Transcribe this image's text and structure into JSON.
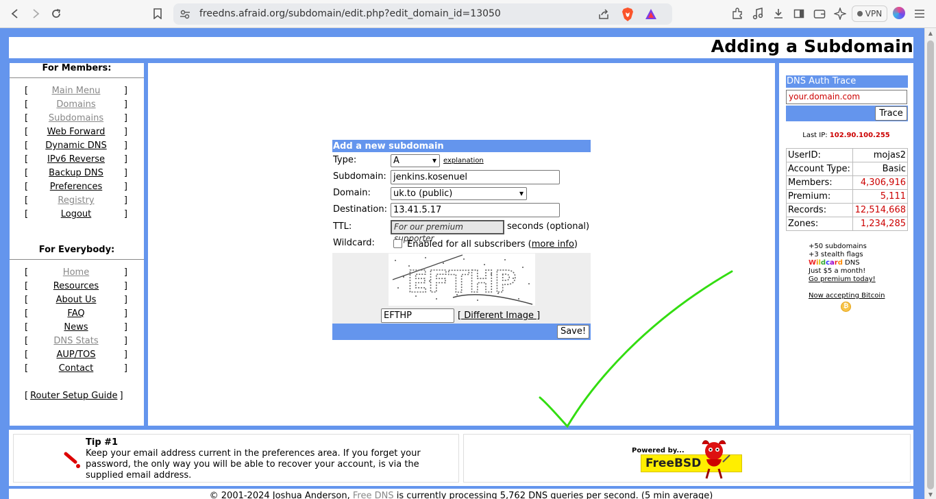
{
  "browser": {
    "url": "freedns.afraid.org/subdomain/edit.php?edit_domain_id=13050",
    "vpn_label": "VPN"
  },
  "page": {
    "title": "Adding a Subdomain"
  },
  "members": {
    "heading": "For Members:",
    "items": [
      {
        "label": "Main Menu"
      },
      {
        "label": "Domains"
      },
      {
        "label": "Subdomains"
      },
      {
        "label": "Web Forward"
      },
      {
        "label": "Dynamic DNS"
      },
      {
        "label": "IPv6 Reverse"
      },
      {
        "label": "Backup DNS"
      },
      {
        "label": "Preferences"
      },
      {
        "label": "Registry"
      },
      {
        "label": "Logout"
      }
    ]
  },
  "everybody": {
    "heading": "For Everybody:",
    "items": [
      {
        "label": "Home"
      },
      {
        "label": "Resources"
      },
      {
        "label": "About Us"
      },
      {
        "label": "FAQ"
      },
      {
        "label": "News"
      },
      {
        "label": "DNS Stats"
      },
      {
        "label": "AUP/TOS"
      },
      {
        "label": "Contact"
      }
    ],
    "router_guide": "Router Setup Guide"
  },
  "form": {
    "heading": "Add a new subdomain",
    "type_label": "Type:",
    "type_value": "A",
    "explanation_link": "explanation",
    "subdomain_label": "Subdomain:",
    "subdomain_value": "jenkins.kosenuel",
    "domain_label": "Domain:",
    "domain_value": "uk.to (public)",
    "destination_label": "Destination:",
    "destination_value": "13.41.5.17",
    "ttl_label": "TTL:",
    "ttl_value": "For our premium supporter",
    "ttl_suffix": "seconds (optional)",
    "wildcard_label": "Wildcard:",
    "wildcard_text": "Enabled for all subscribers (",
    "wildcard_more": "more info",
    "wildcard_close": ")",
    "captcha_text": "EFTHP",
    "captcha_value": "EFTHP",
    "different_image": "[ Different Image ]",
    "save_label": "Save!"
  },
  "trace": {
    "heading": "DNS Auth Trace",
    "placeholder": "your.domain.com",
    "button": "Trace"
  },
  "last_ip": {
    "label": "Last IP:",
    "value": "102.90.100.255"
  },
  "stats": {
    "rows": [
      {
        "label": "UserID:",
        "value": "mojas2"
      },
      {
        "label": "Account Type:",
        "value": "Basic"
      },
      {
        "label": "Members:",
        "value": "4,306,916"
      },
      {
        "label": "Premium:",
        "value": "5,111"
      },
      {
        "label": "Records:",
        "value": "12,514,668"
      },
      {
        "label": "Zones:",
        "value": "1,234,285"
      }
    ]
  },
  "promo": {
    "line1": "+50 subdomains",
    "line2": "+3 stealth flags",
    "line3_suffix": " DNS",
    "line4": "Just $5 a month!",
    "line5": "Go premium today!",
    "bitcoin": "Now accepting Bitcoin"
  },
  "tip": {
    "title": "Tip #1",
    "text": "Keep your email address current in the preferences area. If you forget your password, the only way you will be able to recover your account, is via the supplied email address."
  },
  "freebsd": {
    "powered": "Powered by...",
    "brand": "FreeBSD"
  },
  "footer": {
    "prefix": "© 2001-2024 Joshua Anderson, ",
    "link": "Free DNS",
    "suffix": " is currently processing 5,762 DNS queries per second. (5 min average)"
  },
  "colors": {
    "accent": "#6495ed",
    "stat_value": "#cc0000",
    "checkmark": "#33dd11"
  }
}
